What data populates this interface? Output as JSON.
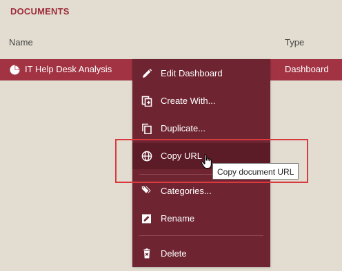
{
  "section": {
    "title": "DOCUMENTS"
  },
  "table": {
    "headers": {
      "name": "Name",
      "type": "Type"
    },
    "row": {
      "name": "IT Help Desk Analysis",
      "type": "Dashboard",
      "icon": "pie-chart-icon"
    }
  },
  "context_menu": {
    "items": [
      {
        "label": "Edit Dashboard",
        "icon": "pencil-icon"
      },
      {
        "label": "Create With...",
        "icon": "create-with-icon"
      },
      {
        "label": "Duplicate...",
        "icon": "duplicate-icon"
      },
      {
        "label": "Copy URL",
        "icon": "globe-icon",
        "hovered": true
      },
      {
        "label": "Categories...",
        "icon": "tag-icon"
      },
      {
        "label": "Rename",
        "icon": "rename-icon"
      },
      {
        "label": "Delete",
        "icon": "trash-icon"
      }
    ]
  },
  "tooltip": {
    "text": "Copy document URL"
  },
  "colors": {
    "background": "#e2ddd0",
    "accent": "#a23343",
    "menu": "#6e2431",
    "menu_hover": "#5b1b27",
    "annotation": "#d93a3f"
  }
}
